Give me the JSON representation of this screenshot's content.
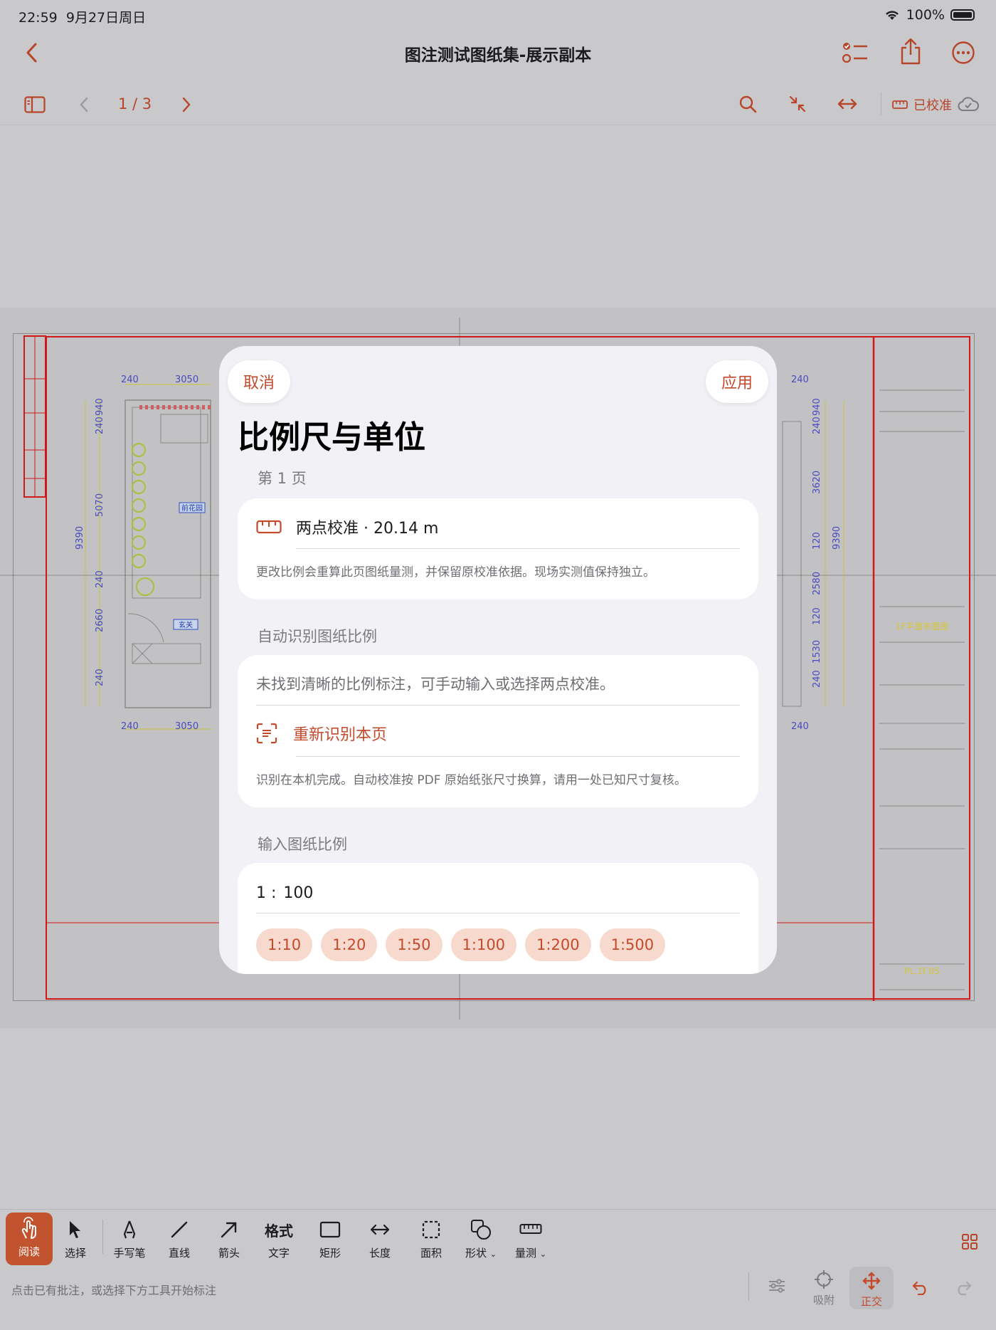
{
  "status_bar": {
    "time": "22:59",
    "date": "9月27日周日",
    "battery": "100%"
  },
  "nav": {
    "title": "图注测试图纸集-展示副本"
  },
  "toolbar": {
    "page": "1 / 3",
    "calibration_status": "已校准"
  },
  "drawing": {
    "dims_left": [
      "240",
      "3050",
      "240",
      "940",
      "5070",
      "9390",
      "240",
      "2660",
      "240",
      "240",
      "3050"
    ],
    "dims_right": [
      "240",
      "940",
      "3620",
      "120",
      "9390",
      "2580",
      "120",
      "1530",
      "240",
      "240"
    ],
    "room_labels": [
      "前花园",
      "玄关"
    ],
    "title_block": {
      "drawing_name": "1F平面布置图",
      "sheet_no": "PL.1F.05"
    }
  },
  "modal": {
    "cancel": "取消",
    "apply": "应用",
    "title": "比例尺与单位",
    "section_page": "第 1 页",
    "calibration_row": "两点校准 · 20.14 m",
    "calibration_note": "更改比例会重算此页图纸量测，并保留原校准依据。现场实测值保持独立。",
    "section_auto": "自动识别图纸比例",
    "auto_message": "未找到清晰的比例标注，可手动输入或选择两点校准。",
    "rescan": "重新识别本页",
    "auto_note": "识别在本机完成。自动校准按 PDF 原始纸张尺寸换算，请用一处已知尺寸复核。",
    "section_input": "输入图纸比例",
    "scale_prefix": "1 :",
    "scale_value": "100",
    "presets": [
      "1:10",
      "1:20",
      "1:50",
      "1:100",
      "1:200",
      "1:500"
    ]
  },
  "bottom": {
    "tools": {
      "read": "阅读",
      "select": "选择",
      "pen": "手写笔",
      "line": "直线",
      "arrow": "箭头",
      "text_icon": "格式",
      "text": "文字",
      "rect": "矩形",
      "length": "长度",
      "area": "面积",
      "shape": "形状",
      "measure": "量测"
    },
    "hint": "点击已有批注，或选择下方工具开始标注",
    "snap": "吸附",
    "ortho": "正交"
  },
  "colors": {
    "accent": "#c44a2c",
    "chip_bg": "#f8d9cd",
    "frame_red": "#d01818"
  }
}
